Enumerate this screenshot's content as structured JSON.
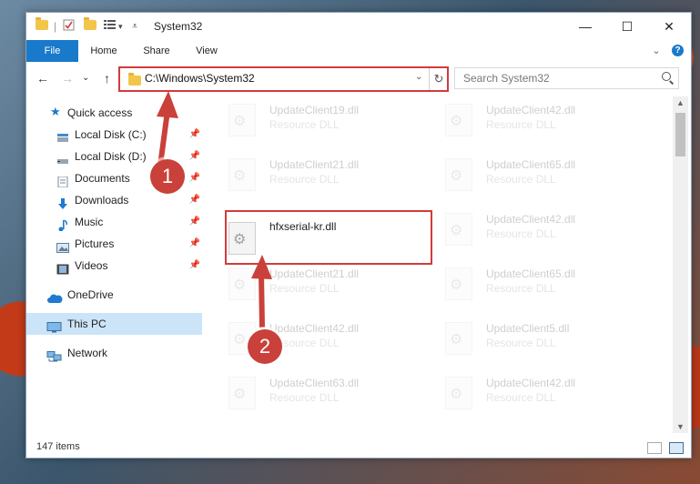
{
  "window": {
    "title": "System32",
    "controls": {
      "minimize": "—",
      "maximize": "☐",
      "close": "✕"
    }
  },
  "ribbon": {
    "tabs": [
      "File",
      "Home",
      "Share",
      "View"
    ],
    "help": "?",
    "expand": "⌄"
  },
  "nav": {
    "back": "←",
    "forward": "→",
    "recent": "⌄",
    "up": "↑",
    "address": "C:\\Windows\\System32",
    "address_dropdown": "⌄",
    "refresh": "↻",
    "search_placeholder": "Search System32"
  },
  "sidebar": {
    "quick_access": "Quick access",
    "items": [
      {
        "label": "Local Disk (C:)",
        "icon": "drive-icon"
      },
      {
        "label": "Local Disk (D:)",
        "icon": "drive-icon"
      },
      {
        "label": "Documents",
        "icon": "documents-icon"
      },
      {
        "label": "Downloads",
        "icon": "downloads-icon"
      },
      {
        "label": "Music",
        "icon": "music-icon"
      },
      {
        "label": "Pictures",
        "icon": "pictures-icon"
      },
      {
        "label": "Videos",
        "icon": "videos-icon"
      }
    ],
    "onedrive": "OneDrive",
    "this_pc": "This PC",
    "network": "Network",
    "pin": "📌"
  },
  "files": {
    "left": [
      {
        "name": "UpdateClient19.dll",
        "type": "Resource DLL"
      },
      {
        "name": "UpdateClient21.dll",
        "type": "Resource DLL"
      },
      {
        "name": "hfxserial-kr.dll",
        "type": ""
      },
      {
        "name": "UpdateClient21.dll",
        "type": "Resource DLL"
      },
      {
        "name": "UpdateClient42.dll",
        "type": "Resource DLL"
      },
      {
        "name": "UpdateClient63.dll",
        "type": "Resource DLL"
      }
    ],
    "right": [
      {
        "name": "UpdateClient42.dll",
        "type": "Resource DLL"
      },
      {
        "name": "UpdateClient65.dll",
        "type": "Resource DLL"
      },
      {
        "name": "UpdateClient42.dll",
        "type": "Resource DLL"
      },
      {
        "name": "UpdateClient65.dll",
        "type": "Resource DLL"
      },
      {
        "name": "UpdateClient5.dll",
        "type": "Resource DLL"
      },
      {
        "name": "UpdateClient42.dll",
        "type": "Resource DLL"
      }
    ]
  },
  "status": {
    "count": "147 items"
  },
  "callouts": [
    "1",
    "2"
  ],
  "colors": {
    "accent": "#1979ca",
    "highlight_red": "#d23b3b",
    "selection": "#cce4f7",
    "callout": "#c9413a"
  }
}
